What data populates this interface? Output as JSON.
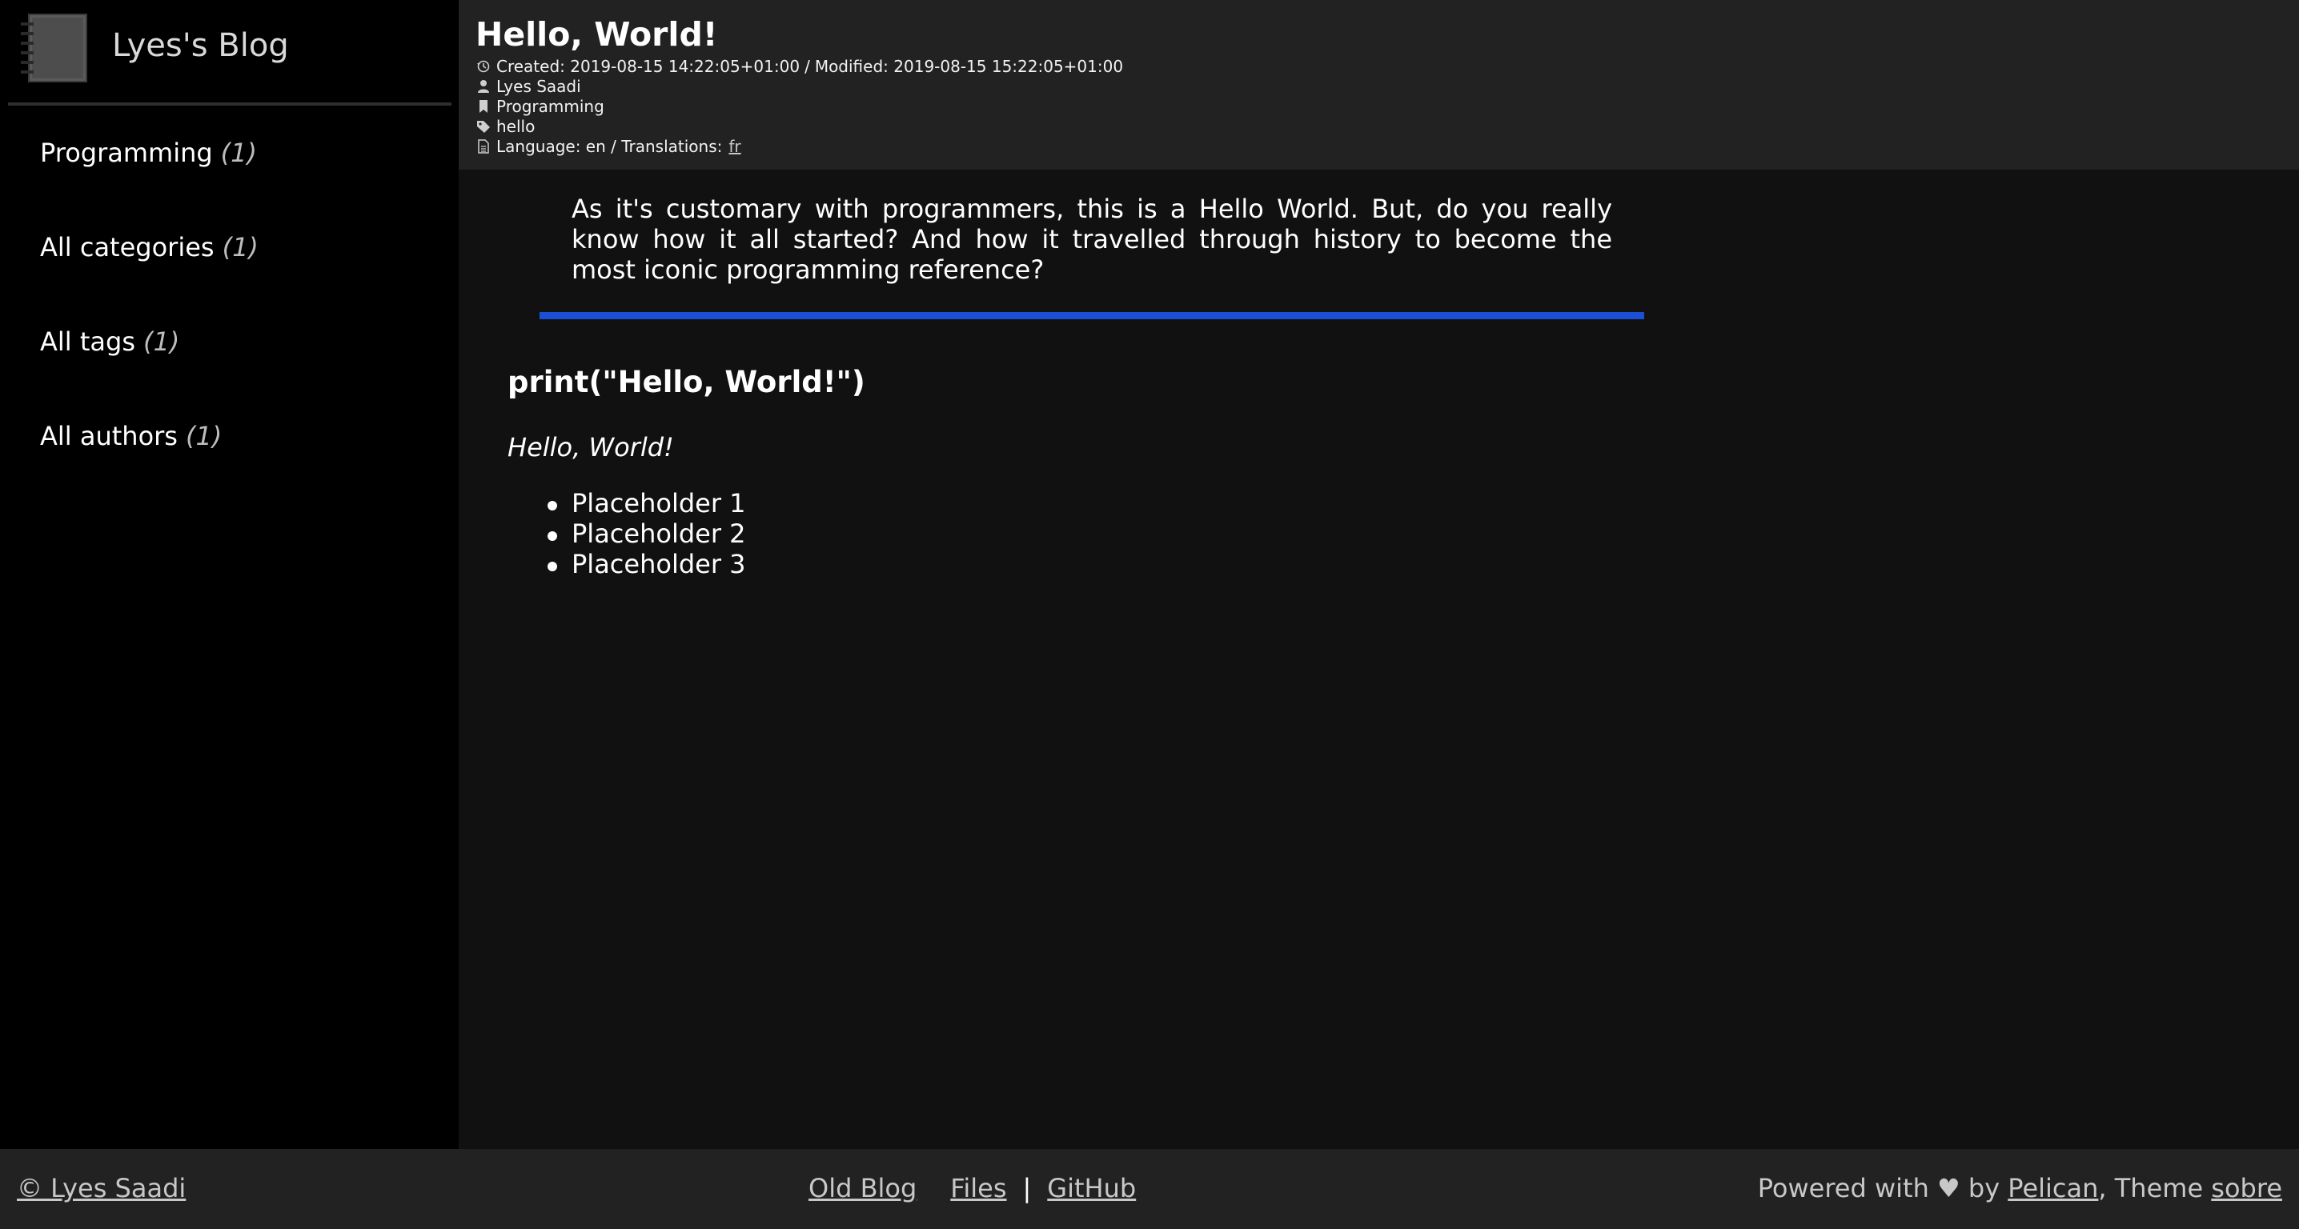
{
  "site": {
    "title": "Lyes's Blog",
    "logo_icon": "notebook-icon"
  },
  "sidebar": {
    "items": [
      {
        "label": "Programming",
        "count": "(1)"
      },
      {
        "label": "All categories",
        "count": "(1)"
      },
      {
        "label": "All tags",
        "count": "(1)"
      },
      {
        "label": "All authors",
        "count": "(1)"
      }
    ]
  },
  "article": {
    "title": "Hello, World!",
    "dates": {
      "created_label": "Created:",
      "created": "2019-08-15 14:22:05+01:00",
      "separator": "/",
      "modified_label": "Modified:",
      "modified": "2019-08-15 15:22:05+01:00"
    },
    "author": "Lyes Saadi",
    "category": "Programming",
    "tag": "hello",
    "language": {
      "text": "Language: en / Translations:",
      "translation_link": "fr"
    },
    "summary": "As it's customary with programmers, this is a Hello World. But, do you really know how it all started? And how it travelled through history to become the most iconic programming reference?",
    "code_heading": "print(\"Hello, World!\")",
    "italic_line": "Hello, World!",
    "list_items": [
      "Placeholder 1",
      "Placeholder 2",
      "Placeholder 3"
    ]
  },
  "colors": {
    "divider": "#1a4fd6",
    "sidebar_bg": "#000000",
    "header_bg": "#222222",
    "content_bg": "#111111"
  },
  "footer": {
    "copyright": "© Lyes Saadi",
    "links": {
      "old_blog": "Old Blog",
      "files": "Files",
      "separator": "|",
      "github": "GitHub"
    },
    "powered_prefix": "Powered with ♥ by",
    "pelican": "Pelican",
    "theme_prefix": ", Theme",
    "theme": "sobre"
  }
}
